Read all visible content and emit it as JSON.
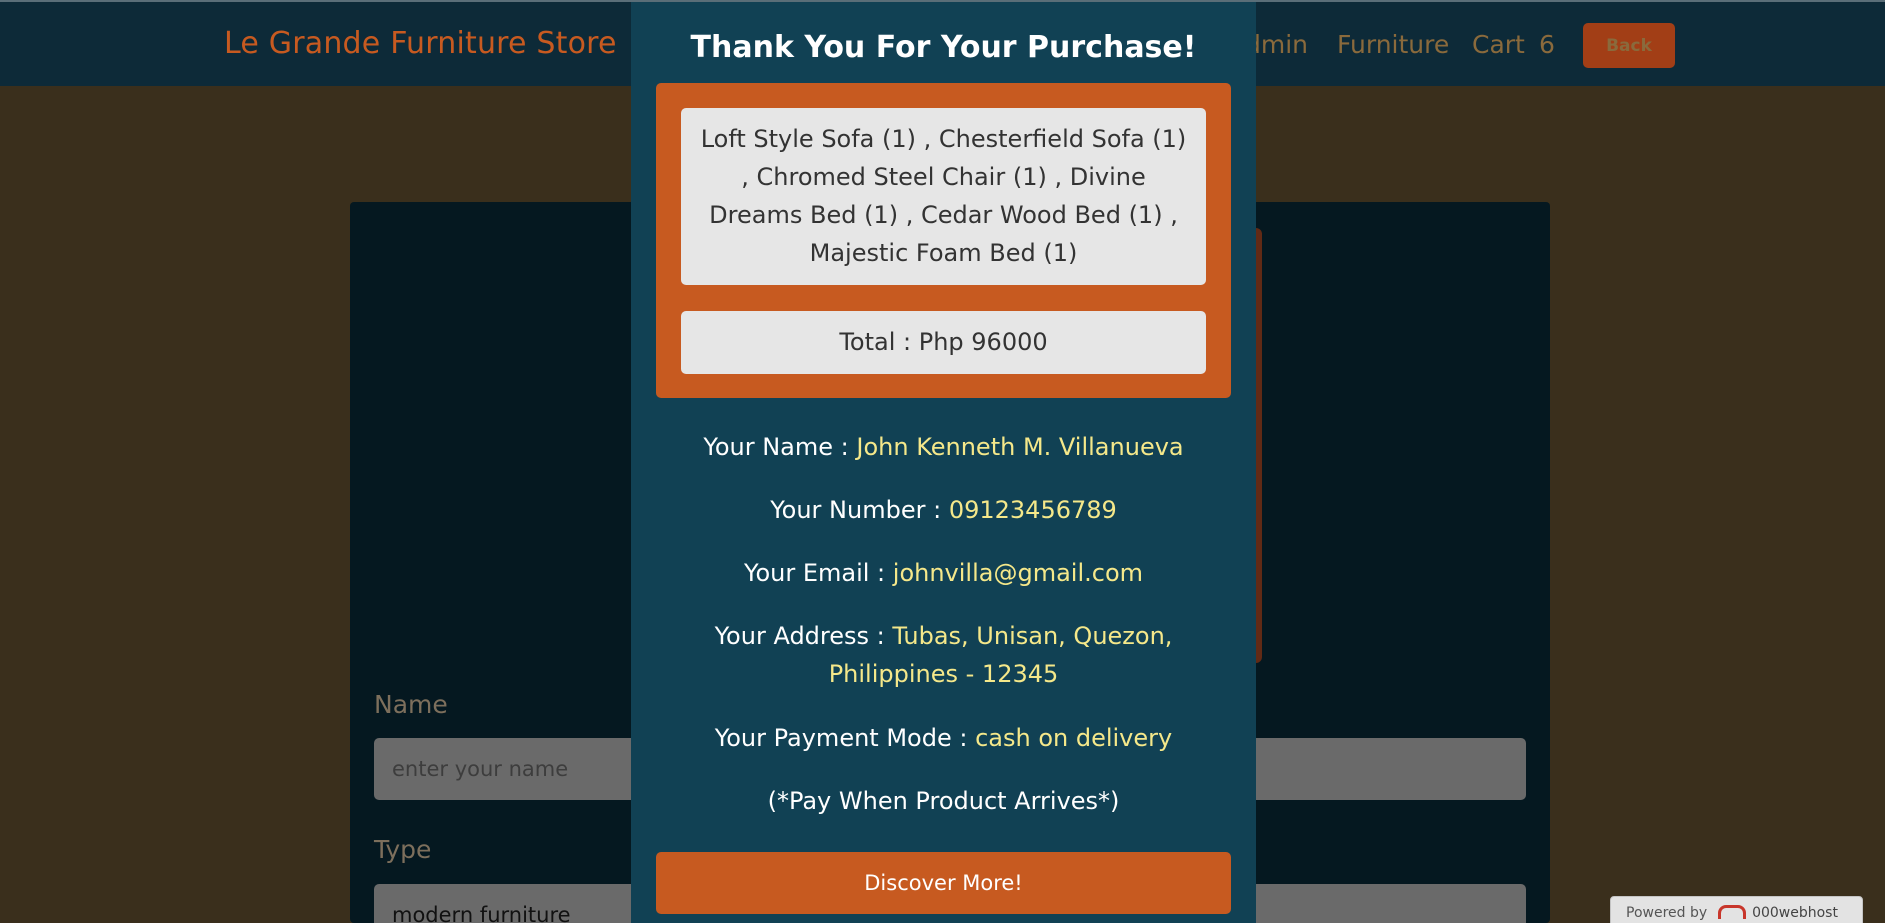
{
  "navbar": {
    "brand": "Le Grande Furniture Store",
    "admin_label": "dmin",
    "furniture_label": "Furniture",
    "cart_label": "Cart",
    "cart_count": "6",
    "back_label": "Back"
  },
  "form": {
    "name_label": "Name",
    "name_placeholder": "enter your name",
    "type_label": "Type",
    "type_value": "modern furniture"
  },
  "modal": {
    "title": "Thank You For Your Purchase!",
    "items_text": "Loft Style Sofa (1) , Chesterfield Sofa (1) , Chromed Steel Chair (1) , Divine Dreams Bed (1) , Cedar Wood Bed (1) , Majestic Foam Bed (1)",
    "total_text": "Total : Php 96000",
    "name_label": "Your Name :",
    "name_value": "John Kenneth M. Villanueva",
    "number_label": "Your Number :",
    "number_value": "09123456789",
    "email_label": "Your Email :",
    "email_value": "johnvilla@gmail.com",
    "address_label": "Your Address :",
    "address_value": "Tubas, Unisan, Quezon, Philippines - 12345",
    "payment_label": "Your Payment Mode :",
    "payment_value": "cash on delivery",
    "note": "(*Pay When Product Arrives*)",
    "discover_label": "Discover More!"
  },
  "badge": {
    "powered_by": "Powered by",
    "brand": "000webhost"
  },
  "colors": {
    "accent": "#c75a20",
    "modal_bg": "#114154",
    "highlight": "#f5e88a"
  }
}
